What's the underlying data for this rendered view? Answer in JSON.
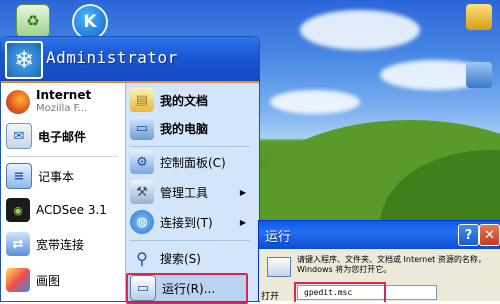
{
  "start_menu": {
    "username": "Administrator",
    "pinned": [
      {
        "title": "Internet",
        "subtitle": "Mozilla F...",
        "icon": "firefox-icon"
      },
      {
        "title": "电子邮件",
        "icon": "email-icon"
      }
    ],
    "recent": [
      {
        "label": "记事本",
        "icon": "notepad-icon"
      },
      {
        "label": "ACDSee 3.1",
        "icon": "acdsee-icon"
      },
      {
        "label": "宽带连接",
        "icon": "broadband-icon"
      },
      {
        "label": "画图",
        "icon": "paint-icon"
      }
    ],
    "places": [
      {
        "label": "我的文档",
        "icon": "my-documents-icon"
      },
      {
        "label": "我的电脑",
        "icon": "my-computer-icon"
      },
      {
        "label": "控制面板(C)",
        "icon": "control-panel-icon"
      },
      {
        "label": "管理工具",
        "icon": "admin-tools-icon",
        "submenu_arrow": "▶"
      },
      {
        "label": "连接到(T)",
        "icon": "connect-to-icon",
        "submenu_arrow": "▶"
      },
      {
        "label": "搜索(S)",
        "icon": "search-icon"
      },
      {
        "label": "运行(R)...",
        "icon": "run-icon"
      }
    ]
  },
  "desktop_icons": [
    {
      "icon": "recycle-bin-icon",
      "glyph": "♻"
    },
    {
      "icon": "k-app-icon",
      "glyph": "K"
    }
  ],
  "run_dialog": {
    "title": "运行",
    "help_glyph": "?",
    "close_glyph": "✕",
    "description": "请键入程序、文件夹、文档或 Internet 资源的名称，Windows 将为您打开它。",
    "open_label": "打开",
    "input_value": "gpedit.msc"
  },
  "colors": {
    "accent_highlight": "#d7265a",
    "start_header": "#1b56d4",
    "places_bg": "#d3e5fa"
  }
}
